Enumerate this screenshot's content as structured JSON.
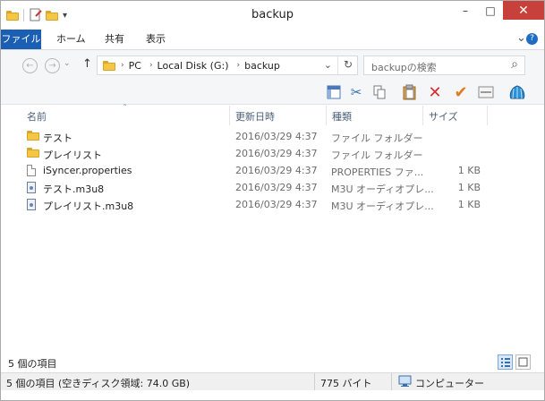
{
  "window": {
    "title": "backup",
    "minimize": "–",
    "maximize": "□",
    "close": "✕",
    "close_color": "#c7403a"
  },
  "quick_access": {
    "dropdown": "▾"
  },
  "ribbon": {
    "tabs": [
      "ファイル",
      "ホーム",
      "共有",
      "表示"
    ],
    "file_tab_color": "#1a5fb4",
    "expand": "⌄",
    "help": "?"
  },
  "address": {
    "back": "←",
    "forward": "→",
    "up": "↑",
    "breadcrumb": [
      "PC",
      "Local Disk (G:)",
      "backup"
    ],
    "separator": "›",
    "dropdown": "⌄",
    "refresh": "↻",
    "search_placeholder": "backupの検索",
    "search_icon": "⌕"
  },
  "toolbar": {
    "icons": [
      "panel-icon",
      "cut-icon",
      "copy-icon",
      "paste-icon",
      "delete-icon",
      "check-icon",
      "window-icon",
      "shell-icon"
    ]
  },
  "columns": {
    "name": "名前",
    "date": "更新日時",
    "type": "種類",
    "size": "サイズ",
    "sort_indicator": "ˆ"
  },
  "files": [
    {
      "icon": "folder-icon",
      "name": "テスト",
      "date": "2016/03/29 4:37",
      "type": "ファイル フォルダー",
      "size": ""
    },
    {
      "icon": "folder-icon",
      "name": "プレイリスト",
      "date": "2016/03/29 4:37",
      "type": "ファイル フォルダー",
      "size": ""
    },
    {
      "icon": "document-icon",
      "name": "iSyncer.properties",
      "date": "2016/03/29 4:37",
      "type": "PROPERTIES ファ...",
      "size": "1 KB"
    },
    {
      "icon": "playlist-file-icon",
      "name": "テスト.m3u8",
      "date": "2016/03/29 4:37",
      "type": "M3U オーディオプレ...",
      "size": "1 KB"
    },
    {
      "icon": "playlist-file-icon",
      "name": "プレイリスト.m3u8",
      "date": "2016/03/29 4:37",
      "type": "M3U オーディオプレ...",
      "size": "1 KB"
    }
  ],
  "status": {
    "item_count": "5 個の項目",
    "details": "5 個の項目 (空きディスク領域: 74.0 GB)",
    "size": "775 バイト",
    "location": "コンピューター"
  }
}
